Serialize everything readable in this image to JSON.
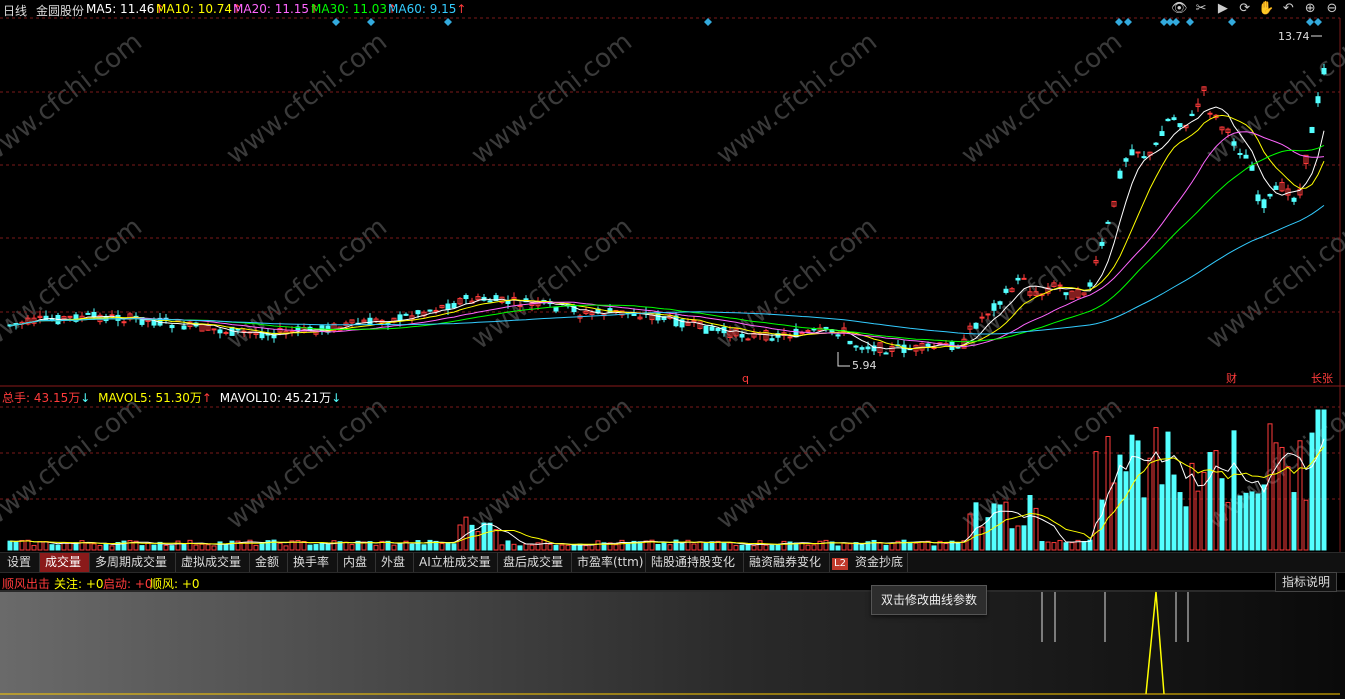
{
  "header": {
    "period": "日线",
    "stock_name": "金圆股份",
    "ma5_label": "MA5: 11.46",
    "ma10_label": "MA10: 10.74",
    "ma20_label": "MA20: 11.15",
    "ma30_label": "MA30: 11.03",
    "ma60_label": "MA60: 9.15",
    "arrow_up": "↑"
  },
  "price_chart": {
    "high_label": "13.74",
    "low_label": "5.94",
    "marker_q": "q",
    "marker_cai": "财",
    "marker_zhang": "长张",
    "watermark": "www.cfchi.com"
  },
  "volume_header": {
    "total_label": "总手: 43.15万",
    "mavol5_label": "MAVOL5: 51.30万",
    "mavol10_label": "MAVOL10: 45.21万",
    "arrow_down": "↓",
    "arrow_up": "↑"
  },
  "tabs": [
    {
      "label": "设置"
    },
    {
      "label": "成交量"
    },
    {
      "label": "多周期成交量"
    },
    {
      "label": "虚拟成交量"
    },
    {
      "label": "金额"
    },
    {
      "label": "换手率"
    },
    {
      "label": "内盘"
    },
    {
      "label": "外盘"
    },
    {
      "label": "AI立桩成交量"
    },
    {
      "label": "盘后成交量"
    },
    {
      "label": "市盈率(ttm)"
    },
    {
      "label": "陆股通持股变化"
    },
    {
      "label": "融资融券变化"
    },
    {
      "label": "L2"
    },
    {
      "label": "资金抄底"
    }
  ],
  "indicator": {
    "name": "顺风出击",
    "guanzhu": "关注: +0",
    "qidong": "启动: +0",
    "shunfeng": "顺风: +0",
    "help_button": "指标说明",
    "tooltip": "双击修改曲线参数"
  },
  "colors": {
    "up": "#ff3b3b",
    "down": "#54ffff",
    "ma5": "#ffffff",
    "ma10": "#ffff00",
    "ma20": "#ff66ff",
    "ma30": "#00ff00",
    "ma60": "#33ccff",
    "grid": "#7a1a1a"
  }
}
